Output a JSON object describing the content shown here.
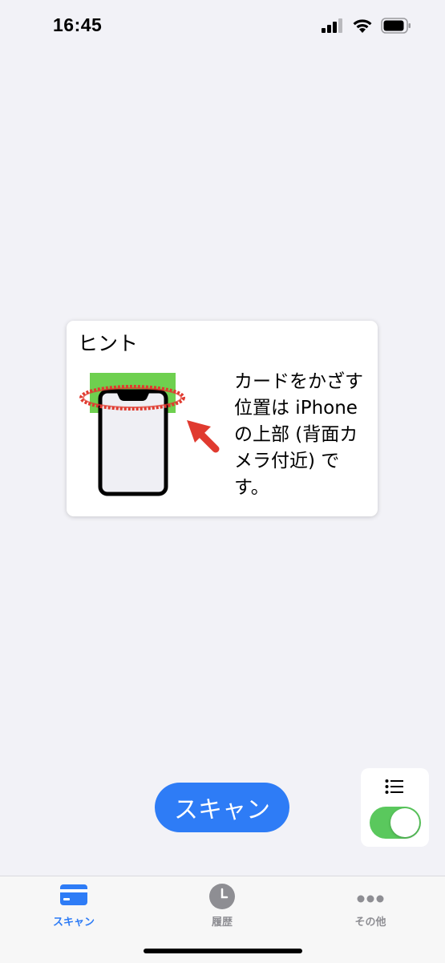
{
  "status_bar": {
    "time": "16:45",
    "icons": [
      "cellular-signal-icon",
      "wifi-icon",
      "battery-icon"
    ]
  },
  "hint": {
    "title": "ヒント",
    "text": "カードをかざす位置は iPhone の上部 (背面カメラ付近) です。",
    "colors": {
      "card_area": "#6ed04f",
      "highlight_ring": "#e03a2f",
      "arrow": "#e03a2f"
    }
  },
  "scan_button": {
    "label": "スキャン",
    "color": "#2e7cf6"
  },
  "toggle_panel": {
    "icon": "list-icon",
    "toggle_on": true,
    "toggle_color": "#5ac85d"
  },
  "tab_bar": {
    "tabs": [
      {
        "label": "スキャン",
        "icon": "card-icon",
        "active": true
      },
      {
        "label": "履歴",
        "icon": "clock-icon",
        "active": false
      },
      {
        "label": "その他",
        "icon": "more-icon",
        "active": false
      }
    ],
    "active_color": "#2e7cf6",
    "inactive_color": "#8e8e93"
  }
}
